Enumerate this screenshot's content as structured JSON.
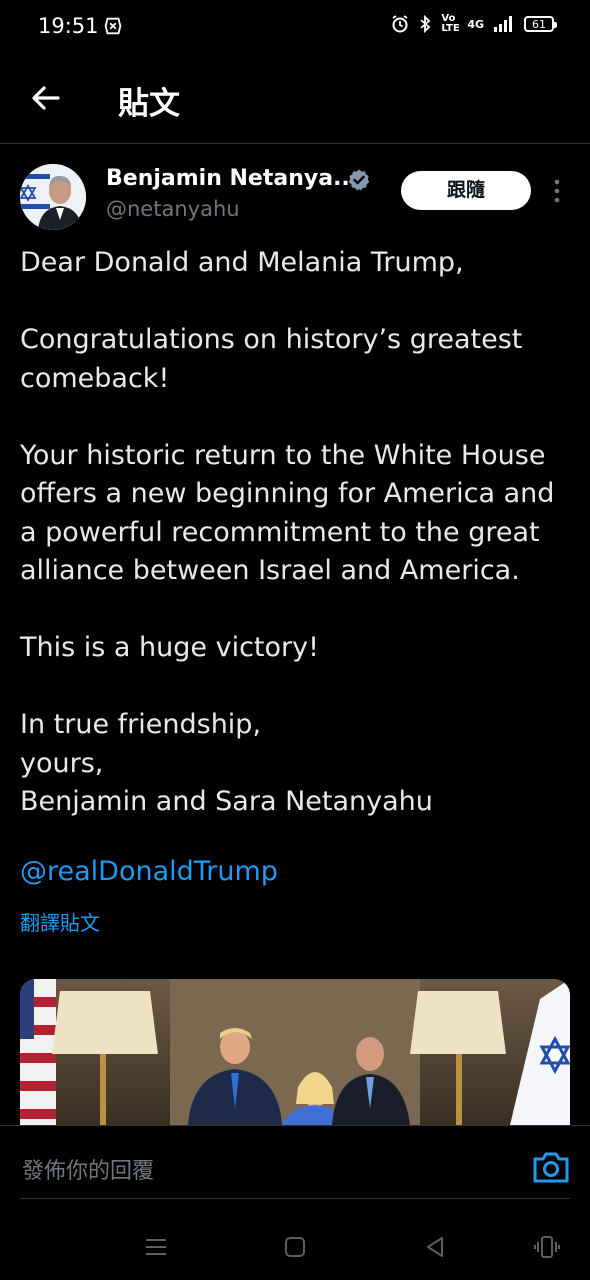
{
  "status_bar": {
    "time": "19:51",
    "network": "4G",
    "volte": "Vo LTE",
    "battery": "61"
  },
  "header": {
    "title": "貼文"
  },
  "tweet": {
    "author_name": "Benjamin Netanya...",
    "author_handle": "@netanyahu",
    "follow_label": "跟隨",
    "paragraphs": [
      "Dear Donald and Melania Trump,",
      "Congratulations on history’s greatest comeback!",
      "Your historic return to the White House offers a new beginning for America and a powerful recommitment to the great alliance between Israel and America.",
      "This is a huge victory!",
      "In true friendship,\nyours,\nBenjamin and Sara Netanyahu"
    ],
    "mention": "@realDonaldTrump",
    "translate_label": "翻譯貼文"
  },
  "reply": {
    "placeholder": "發佈你的回覆"
  },
  "colors": {
    "accent": "#1d9bf0",
    "background": "#000000",
    "text": "#e7e9ea",
    "muted": "#71767b"
  },
  "icons": [
    "back-arrow-icon",
    "verified-badge-icon",
    "more-vertical-icon",
    "camera-icon",
    "menu-icon",
    "home-square-icon",
    "back-triangle-icon",
    "vibrate-icon"
  ]
}
